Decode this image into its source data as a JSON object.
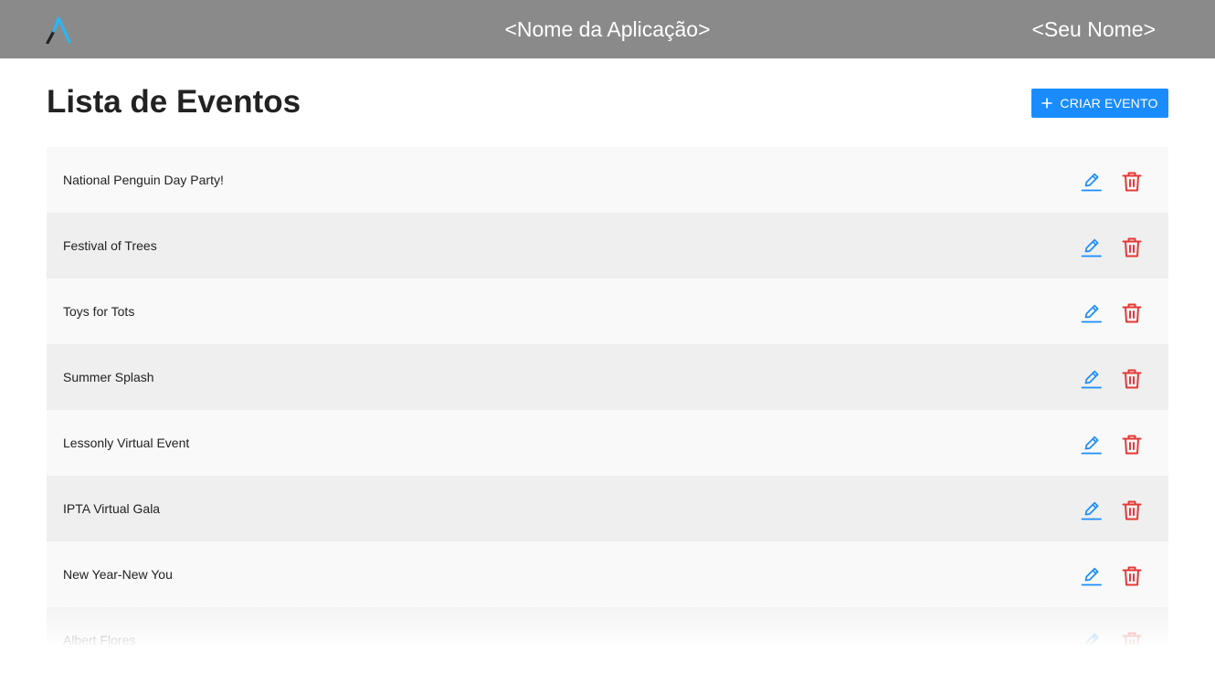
{
  "header": {
    "app_name": "<Nome da Aplicação>",
    "user_name": "<Seu Nome>",
    "logo_icon": "logo-a-icon"
  },
  "main": {
    "title": "Lista de Eventos",
    "create_button_label": "CRIAR EVENTO"
  },
  "events": [
    {
      "name": "National Penguin Day Party!"
    },
    {
      "name": "Festival of Trees"
    },
    {
      "name": "Toys for Tots"
    },
    {
      "name": "Summer Splash"
    },
    {
      "name": "Lessonly Virtual Event"
    },
    {
      "name": "IPTA Virtual Gala"
    },
    {
      "name": "New Year-New You"
    },
    {
      "name": "Albert Flores"
    }
  ],
  "icons": {
    "edit": "pencil-icon",
    "delete": "trash-icon",
    "create": "plus-icon"
  },
  "colors": {
    "header_bg": "#8a8a8a",
    "accent": "#1a8cff",
    "danger": "#e53935",
    "logo_cyan": "#29b6f6"
  }
}
